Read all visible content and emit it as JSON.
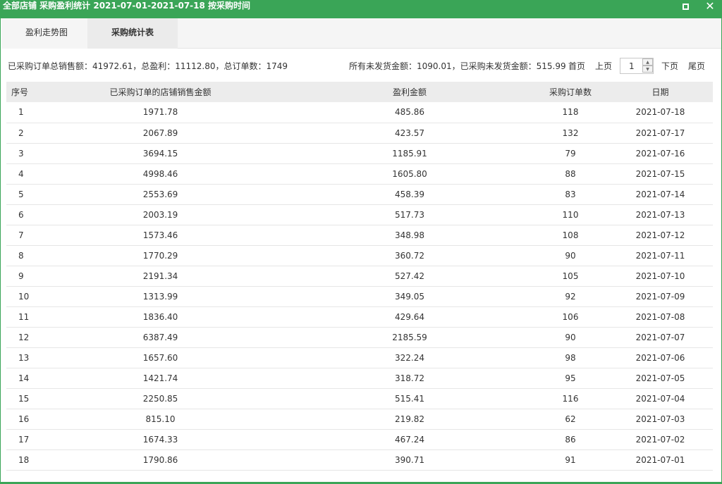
{
  "window": {
    "title": "全部店铺 采购盈利统计 2021-07-01-2021-07-18 按采购时间",
    "close_symbol": "✕"
  },
  "tabs": [
    {
      "label": "盈利走势图"
    },
    {
      "label": "采购统计表"
    }
  ],
  "summary": {
    "left": "已采购订单总销售额：41972.61，总盈利：11112.80，总订单数：1749",
    "right": "所有未发货金额：1090.01，已采购未发货金额：515.99"
  },
  "pager": {
    "first": "首页",
    "prev": "上页",
    "page": "1",
    "next": "下页",
    "last": "尾页"
  },
  "table": {
    "headers": [
      "序号",
      "已采购订单的店铺销售金额",
      "盈利金额",
      "采购订单数",
      "日期"
    ],
    "rows": [
      [
        "1",
        "1971.78",
        "485.86",
        "118",
        "2021-07-18"
      ],
      [
        "2",
        "2067.89",
        "423.57",
        "132",
        "2021-07-17"
      ],
      [
        "3",
        "3694.15",
        "1185.91",
        "79",
        "2021-07-16"
      ],
      [
        "4",
        "4998.46",
        "1605.80",
        "88",
        "2021-07-15"
      ],
      [
        "5",
        "2553.69",
        "458.39",
        "83",
        "2021-07-14"
      ],
      [
        "6",
        "2003.19",
        "517.73",
        "110",
        "2021-07-13"
      ],
      [
        "7",
        "1573.46",
        "348.98",
        "108",
        "2021-07-12"
      ],
      [
        "8",
        "1770.29",
        "360.72",
        "90",
        "2021-07-11"
      ],
      [
        "9",
        "2191.34",
        "527.42",
        "105",
        "2021-07-10"
      ],
      [
        "10",
        "1313.99",
        "349.05",
        "92",
        "2021-07-09"
      ],
      [
        "11",
        "1836.40",
        "429.64",
        "106",
        "2021-07-08"
      ],
      [
        "12",
        "6387.49",
        "2185.59",
        "90",
        "2021-07-07"
      ],
      [
        "13",
        "1657.60",
        "322.24",
        "98",
        "2021-07-06"
      ],
      [
        "14",
        "1421.74",
        "318.72",
        "95",
        "2021-07-05"
      ],
      [
        "15",
        "2250.85",
        "515.41",
        "116",
        "2021-07-04"
      ],
      [
        "16",
        "815.10",
        "219.82",
        "62",
        "2021-07-03"
      ],
      [
        "17",
        "1674.33",
        "467.24",
        "86",
        "2021-07-02"
      ],
      [
        "18",
        "1790.86",
        "390.71",
        "91",
        "2021-07-01"
      ]
    ]
  },
  "colors": {
    "accent": "#3aa557",
    "header_bg": "#ececec",
    "tab_active_bg": "#ebebeb"
  },
  "icons": {
    "maximize": "maximize-icon",
    "close": "close-icon",
    "spin_up": "spin-up-icon",
    "spin_down": "spin-down-icon"
  }
}
